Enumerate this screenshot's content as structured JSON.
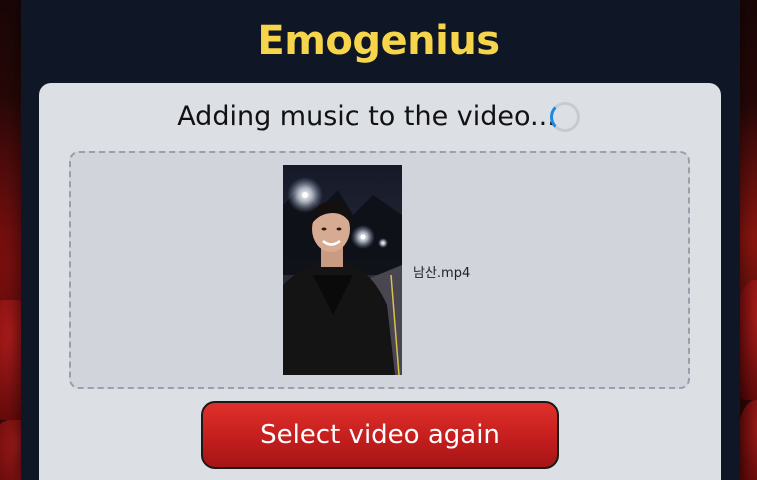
{
  "app": {
    "title": "Emogenius",
    "title_color": "#f7d54a"
  },
  "status": {
    "text": "Adding music to the video...",
    "spinner_icon": "loading-spinner-icon"
  },
  "upload": {
    "file_name": "남산.mp4",
    "thumbnail_description": "video-thumbnail"
  },
  "actions": {
    "select_again_label": "Select video again"
  },
  "colors": {
    "button_red": "#c41e1e",
    "card_bg": "#dcdfe4",
    "panel_bg": "#0f1626"
  }
}
